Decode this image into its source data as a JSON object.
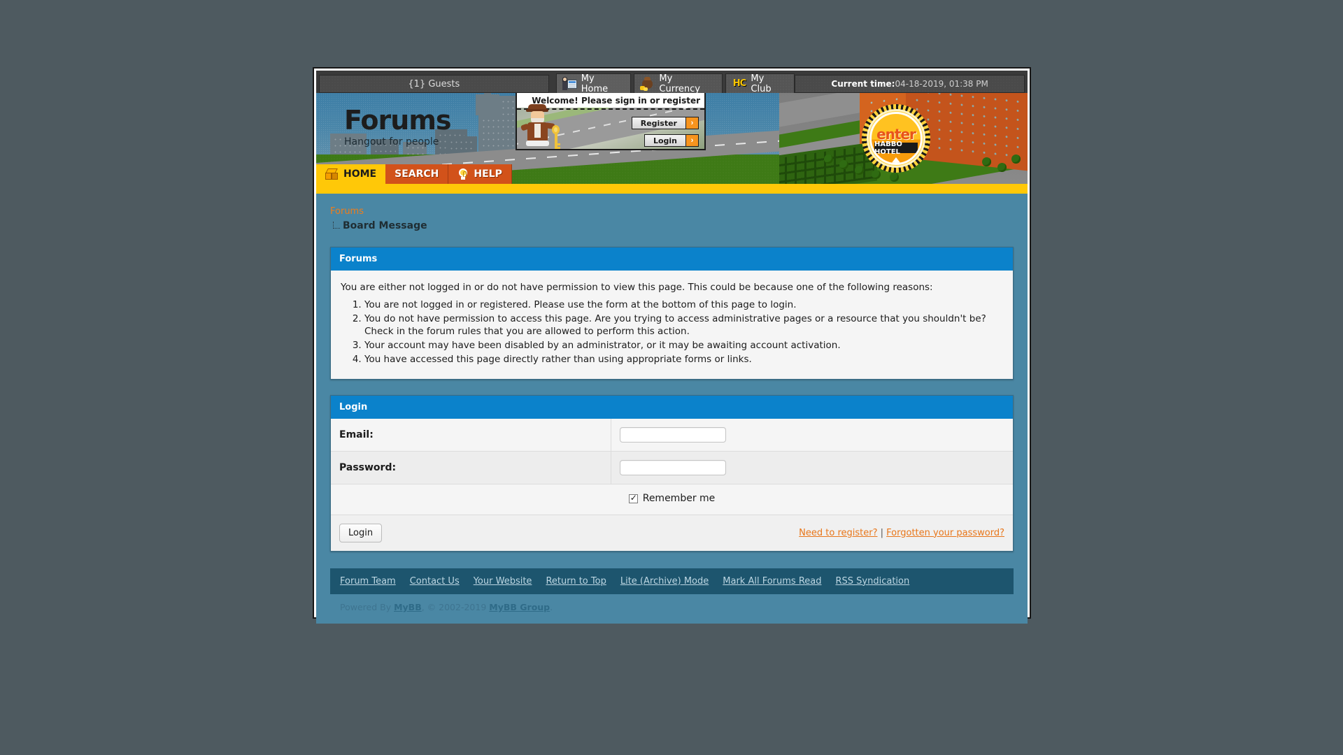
{
  "topbar": {
    "guests_label": "{1} Guests",
    "tabs": [
      {
        "label": "My Home",
        "icon": "home-person-icon",
        "active": true
      },
      {
        "label": "My Currency",
        "icon": "coin-bag-icon",
        "active": false
      },
      {
        "label": "My Club",
        "icon": "hc-badge-icon",
        "active": false
      }
    ],
    "time_prefix": "Current time:",
    "time_value": "04-18-2019, 01:38 PM"
  },
  "banner": {
    "logo_title": "Forums",
    "logo_subtitle": "Hangout for people",
    "welcome_message": "Welcome! Please sign in or register",
    "register_button": "Register",
    "login_button": "Login",
    "arrow_glyph": "›",
    "badge_enter": "enter",
    "badge_hotel": "HABBO HOTEL"
  },
  "nav": {
    "items": [
      {
        "label": "HOME",
        "icon": "box-icon",
        "active": true
      },
      {
        "label": "SEARCH",
        "icon": "none",
        "active": false
      },
      {
        "label": "HELP",
        "icon": "bulb-icon",
        "active": false
      }
    ]
  },
  "breadcrumb": {
    "root": "Forums",
    "current": "Board Message"
  },
  "message_panel": {
    "title": "Forums",
    "intro": "You are either not logged in or do not have permission to view this page. This could be because one of the following reasons:",
    "reasons": [
      "You are not logged in or registered. Please use the form at the bottom of this page to login.",
      "You do not have permission to access this page. Are you trying to access administrative pages or a resource that you shouldn't be? Check in the forum rules that you are allowed to perform this action.",
      "Your account may have been disabled by an administrator, or it may be awaiting account activation.",
      "You have accessed this page directly rather than using appropriate forms or links."
    ]
  },
  "login_panel": {
    "title": "Login",
    "email_label": "Email:",
    "email_value": "",
    "password_label": "Password:",
    "password_value": "",
    "remember_label": "Remember me",
    "remember_checked": true,
    "submit_label": "Login",
    "need_register_link": "Need to register?",
    "separator": "|",
    "forgot_link": "Forgotten your password?"
  },
  "footer": {
    "links": [
      "Forum Team",
      "Contact Us",
      "Your Website",
      "Return to Top",
      "Lite (Archive) Mode",
      "Mark All Forums Read",
      "RSS Syndication"
    ],
    "powered_prefix": "Powered By",
    "powered_name": "MyBB",
    "copyright": ", © 2002-2019",
    "group_name": "MyBB Group",
    "period": "."
  },
  "colors": {
    "page_bg": "#4e5a60",
    "content_bg": "#4a87a4",
    "panel_header": "#0b82cb",
    "accent_orange": "#f07d1a",
    "nav_active": "#ffc808",
    "nav_inactive": "#d2521a",
    "footer_bar": "#1d556e"
  }
}
